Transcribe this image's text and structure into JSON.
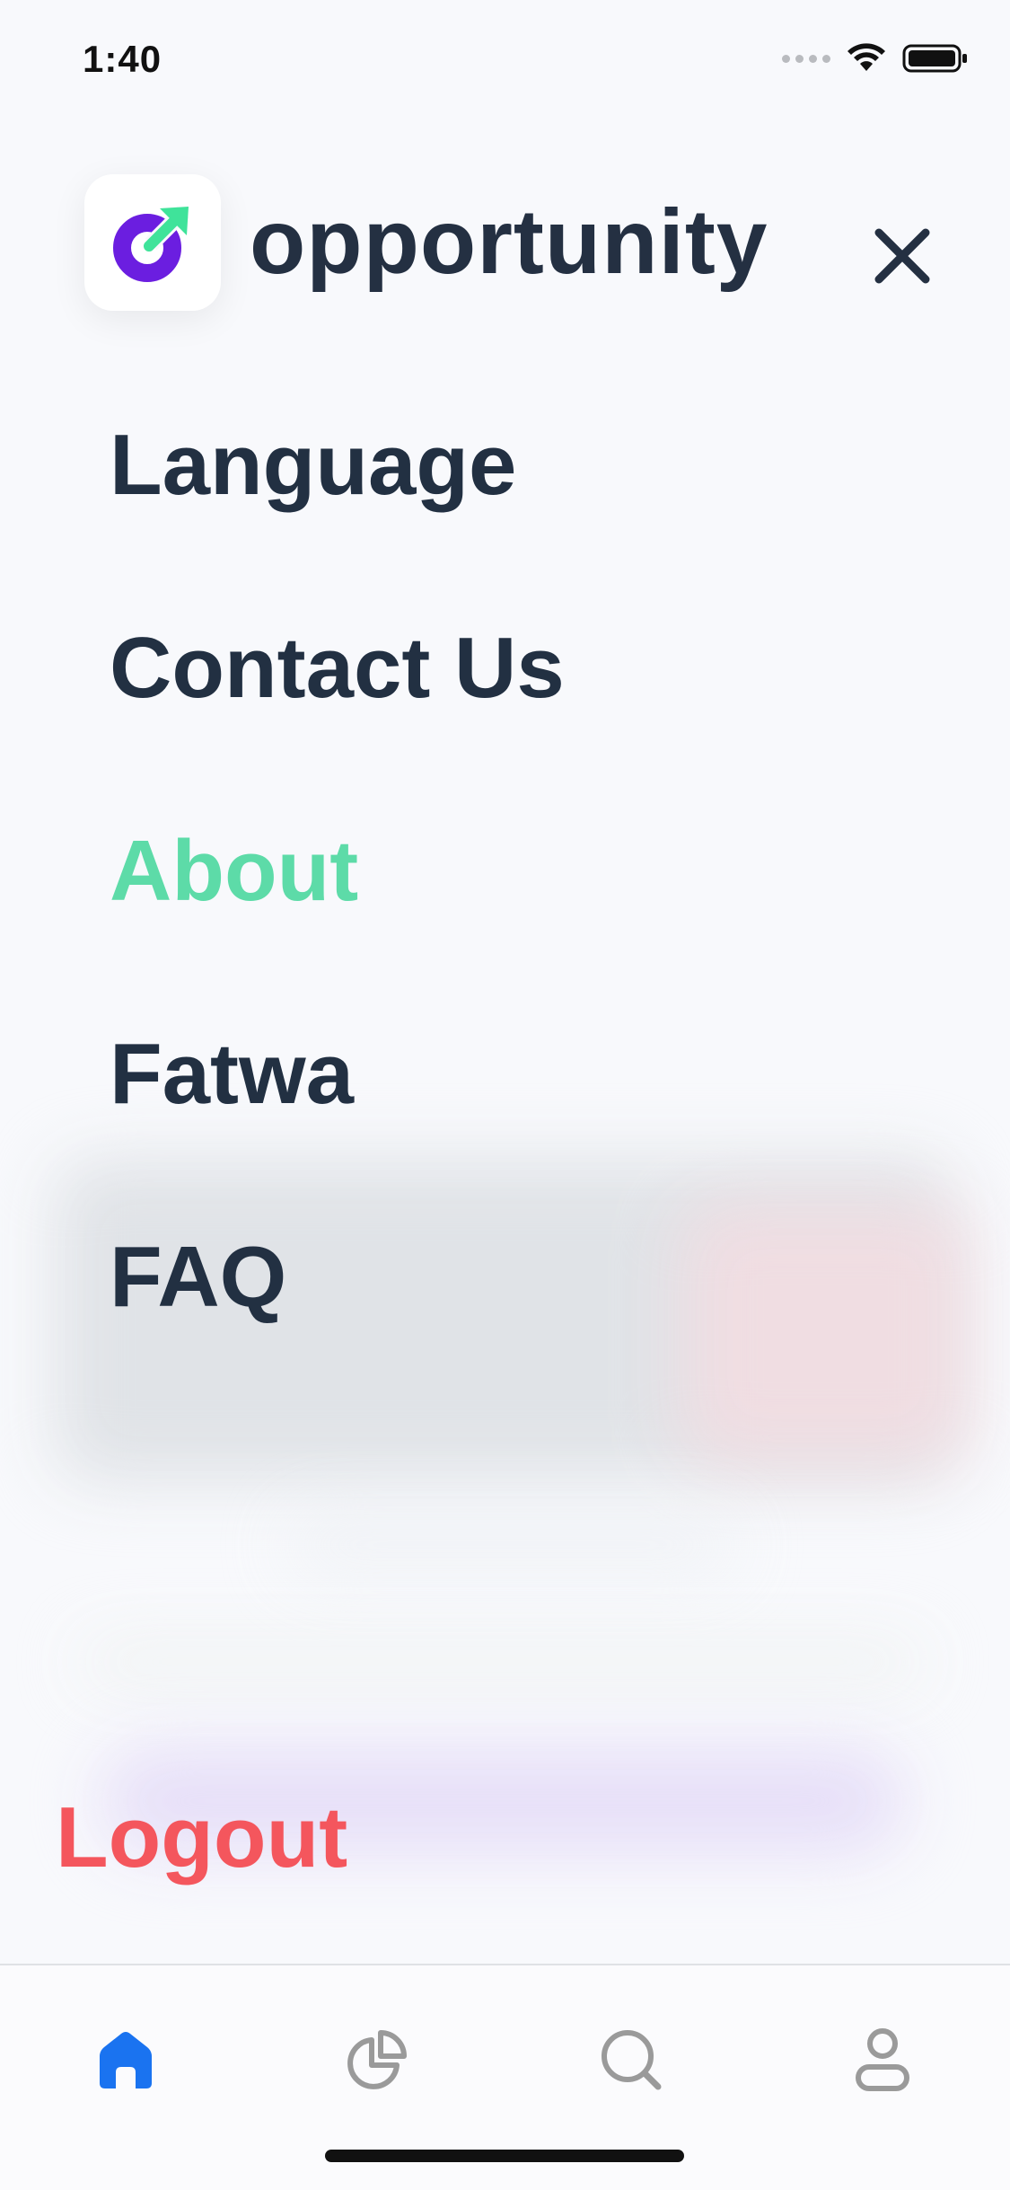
{
  "status_bar": {
    "time": "1:40"
  },
  "header": {
    "brand_name": "opportunity",
    "logo_icon": "opportunity-logo-icon",
    "close_icon": "close-icon"
  },
  "menu": {
    "items": [
      {
        "label": "Language",
        "active": false
      },
      {
        "label": "Contact Us",
        "active": false
      },
      {
        "label": "About",
        "active": true
      },
      {
        "label": "Fatwa",
        "active": false
      },
      {
        "label": "FAQ",
        "active": false
      }
    ],
    "logout_label": "Logout"
  },
  "tab_bar": {
    "tabs": [
      {
        "icon": "home-icon",
        "active": true
      },
      {
        "icon": "pie-chart-icon",
        "active": false
      },
      {
        "icon": "search-icon",
        "active": false
      },
      {
        "icon": "profile-icon",
        "active": false
      }
    ]
  },
  "colors": {
    "text_primary": "#223042",
    "active_item": "#5ddba8",
    "logout": "#f4565d",
    "tab_active": "#1a73f0",
    "tab_inactive": "#9a9a9a",
    "logo_purple": "#6b1ee0",
    "logo_green": "#3fe39a"
  }
}
